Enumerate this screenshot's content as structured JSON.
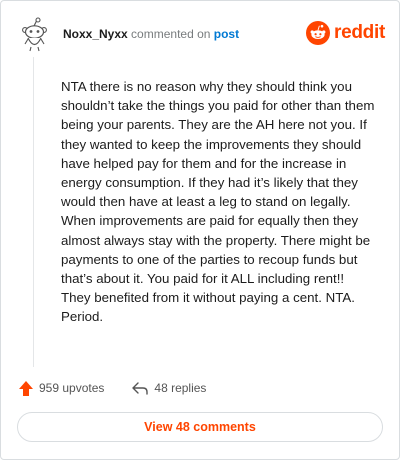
{
  "header": {
    "username": "Noxx_Nyxx",
    "verb": " commented on ",
    "post_link": "post",
    "brand": "reddit",
    "brand_color": "#ff4500"
  },
  "comment": {
    "body": "NTA there is no reason why they should think you shouldn’t take the things you paid for other than them being your parents. They are the AH here not you. If they wanted to keep the improvements they should have helped pay for them and for the increase in energy consumption. If they had it’s likely that they would then have at least a leg to stand on legally. When improvements are paid for equally then they almost always stay with the property. There might be payments to one of the parties to recoup funds but that’s about it. You paid for it ALL including rent!! They benefited from it without paying a cent. NTA. Period."
  },
  "actions": {
    "upvotes": "959 upvotes",
    "replies": "48 replies",
    "upvote_icon": "upvote-arrow-icon",
    "reply_icon": "reply-arrow-icon"
  },
  "footer": {
    "view_comments": "View 48 comments"
  }
}
